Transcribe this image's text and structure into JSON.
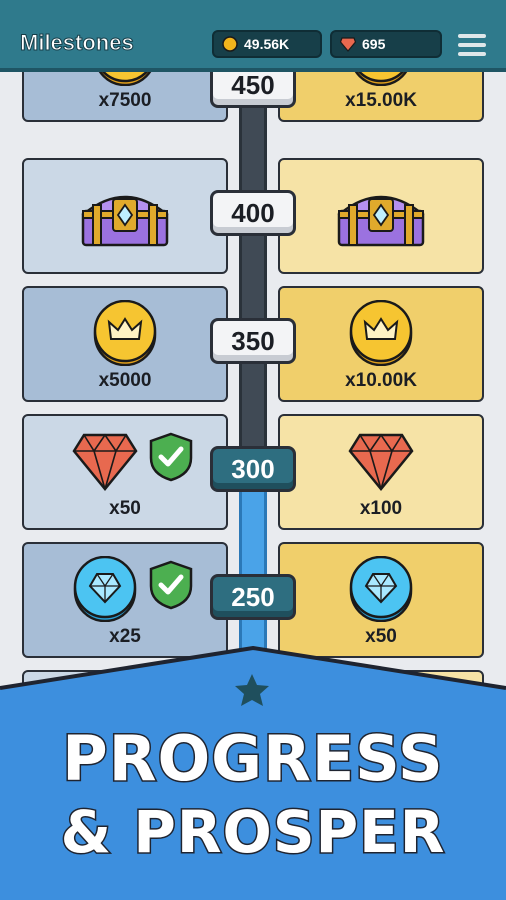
{
  "header": {
    "title": "Milestones",
    "coins": "49.56K",
    "gems": "695"
  },
  "colors": {
    "header_bg": "#2f7a8c",
    "free_card": "#a7bdd6",
    "premium_card": "#f0cf6b",
    "progress_fill": "#4aa3e8",
    "banner": "#3d8fde"
  },
  "milestones": [
    {
      "level": "450",
      "reached": false,
      "free": {
        "item": "crown-coin-icon",
        "amount": "x7500"
      },
      "premium": {
        "item": "crown-coin-icon",
        "amount": "x15.00K"
      }
    },
    {
      "level": "400",
      "reached": false,
      "free": {
        "item": "chest-icon",
        "amount": ""
      },
      "premium": {
        "item": "chest-icon",
        "amount": ""
      }
    },
    {
      "level": "350",
      "reached": false,
      "free": {
        "item": "crown-coin-icon",
        "amount": "x5000"
      },
      "premium": {
        "item": "crown-coin-icon",
        "amount": "x10.00K"
      }
    },
    {
      "level": "300",
      "reached": true,
      "free": {
        "item": "red-gem-icon",
        "amount": "x50",
        "claimed": true
      },
      "premium": {
        "item": "red-gem-icon",
        "amount": "x100"
      }
    },
    {
      "level": "250",
      "reached": true,
      "free": {
        "item": "blue-gem-coin-icon",
        "amount": "x25",
        "claimed": true
      },
      "premium": {
        "item": "blue-gem-coin-icon",
        "amount": "x50"
      }
    }
  ],
  "promo": {
    "line1": "PROGRESS",
    "line2": "& PROSPER"
  }
}
